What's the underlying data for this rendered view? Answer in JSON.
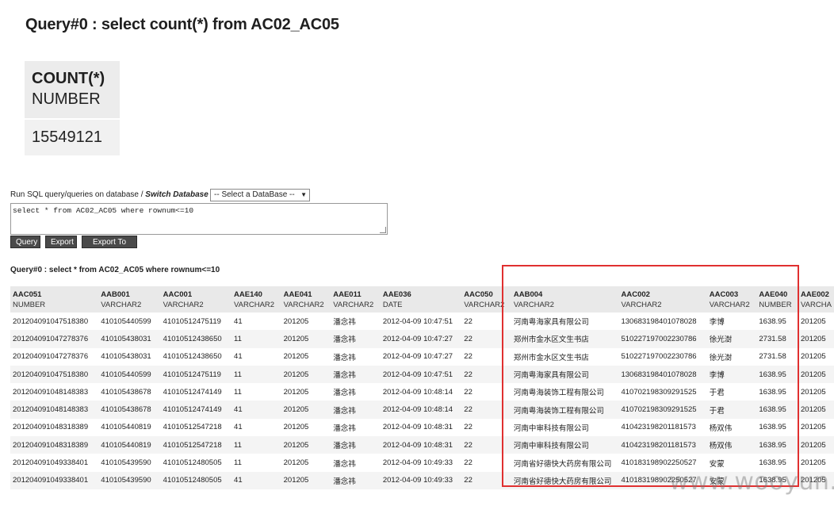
{
  "query_title": "Query#0 : select count(*) from AC02_AC05",
  "count_result": {
    "column": "COUNT(*)",
    "type": "NUMBER",
    "value": "15549121"
  },
  "run_line": {
    "prefix": "Run SQL query/queries on database / ",
    "switch_label": "Switch Database :"
  },
  "db_select": {
    "value": "-- Select a DataBase --"
  },
  "sql_text": "select * from AC02_AC05 where rownum<=10",
  "buttons": {
    "query": "Query",
    "export": "Export",
    "export_file": "Export To File"
  },
  "result_title": "Query#0 : select * from AC02_AC05 where rownum<=10",
  "columns": [
    {
      "name": "AAC051",
      "type": "NUMBER"
    },
    {
      "name": "AAB001",
      "type": "VARCHAR2"
    },
    {
      "name": "AAC001",
      "type": "VARCHAR2"
    },
    {
      "name": "AAE140",
      "type": "VARCHAR2"
    },
    {
      "name": "AAE041",
      "type": "VARCHAR2"
    },
    {
      "name": "AAE011",
      "type": "VARCHAR2"
    },
    {
      "name": "AAE036",
      "type": "DATE"
    },
    {
      "name": "AAC050",
      "type": "VARCHAR2"
    },
    {
      "name": "AAB004",
      "type": "VARCHAR2"
    },
    {
      "name": "AAC002",
      "type": "VARCHAR2"
    },
    {
      "name": "AAC003",
      "type": "VARCHAR2"
    },
    {
      "name": "AAE040",
      "type": "NUMBER"
    },
    {
      "name": "AAE002",
      "type": "VARCHA"
    }
  ],
  "rows": [
    [
      "201204091047518380",
      "410105440599",
      "41010512475119",
      "41",
      "201205",
      "潘念祎",
      "2012-04-09 10:47:51",
      "22",
      "河南粤海家具有限公司",
      "130683198401078028",
      "李博",
      "1638.95",
      "201205"
    ],
    [
      "201204091047278376",
      "410105438031",
      "41010512438650",
      "11",
      "201205",
      "潘念祎",
      "2012-04-09 10:47:27",
      "22",
      "郑州市金水区文生书店",
      "510227197002230786",
      "徐光澍",
      "2731.58",
      "201205"
    ],
    [
      "201204091047278376",
      "410105438031",
      "41010512438650",
      "41",
      "201205",
      "潘念祎",
      "2012-04-09 10:47:27",
      "22",
      "郑州市金水区文生书店",
      "510227197002230786",
      "徐光澍",
      "2731.58",
      "201205"
    ],
    [
      "201204091047518380",
      "410105440599",
      "41010512475119",
      "11",
      "201205",
      "潘念祎",
      "2012-04-09 10:47:51",
      "22",
      "河南粤海家具有限公司",
      "130683198401078028",
      "李博",
      "1638.95",
      "201205"
    ],
    [
      "201204091048148383",
      "410105438678",
      "41010512474149",
      "11",
      "201205",
      "潘念祎",
      "2012-04-09 10:48:14",
      "22",
      "河南粤海装饰工程有限公司",
      "410702198309291525",
      "于君",
      "1638.95",
      "201205"
    ],
    [
      "201204091048148383",
      "410105438678",
      "41010512474149",
      "41",
      "201205",
      "潘念祎",
      "2012-04-09 10:48:14",
      "22",
      "河南粤海装饰工程有限公司",
      "410702198309291525",
      "于君",
      "1638.95",
      "201205"
    ],
    [
      "201204091048318389",
      "410105440819",
      "41010512547218",
      "41",
      "201205",
      "潘念祎",
      "2012-04-09 10:48:31",
      "22",
      "河南中审科技有限公司",
      "410423198201181573",
      "杨双伟",
      "1638.95",
      "201205"
    ],
    [
      "201204091048318389",
      "410105440819",
      "41010512547218",
      "11",
      "201205",
      "潘念祎",
      "2012-04-09 10:48:31",
      "22",
      "河南中审科技有限公司",
      "410423198201181573",
      "杨双伟",
      "1638.95",
      "201205"
    ],
    [
      "201204091049338401",
      "410105439590",
      "41010512480505",
      "11",
      "201205",
      "潘念祎",
      "2012-04-09 10:49:33",
      "22",
      "河南省好德快大药房有限公司",
      "410183198902250527",
      "安蒙",
      "1638.95",
      "201205"
    ],
    [
      "201204091049338401",
      "410105439590",
      "41010512480505",
      "41",
      "201205",
      "潘念祎",
      "2012-04-09 10:49:33",
      "22",
      "河南省好德快大药房有限公司",
      "410183198902250527",
      "安蒙",
      "1638.95",
      "201205"
    ]
  ],
  "watermark": "www.wooyun.org",
  "colors": {
    "highlight_border": "#e03030",
    "button_bg": "#4a4a4a",
    "header_bg": "#e9e9e9"
  }
}
